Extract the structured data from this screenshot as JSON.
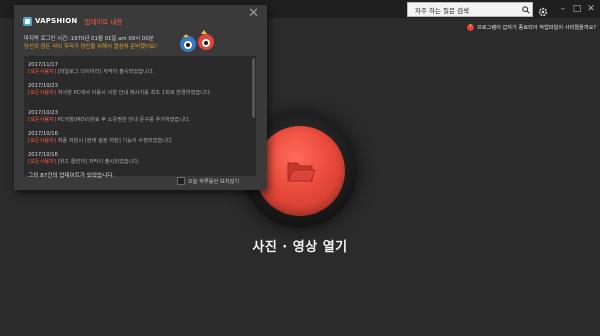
{
  "titlebar": {
    "search_placeholder": "자주 하는 질문 검색",
    "controls": [
      "–",
      "□",
      "✕"
    ]
  },
  "notice": {
    "badge": "!",
    "text": "프로그램이 갑자기 종료되어 작업파일이 사라졌을까요?"
  },
  "main": {
    "open_label": "사진 · 영상 열기"
  },
  "dialog": {
    "brand": "VAPSHION",
    "title": "업데이트 내용",
    "intro_line1_prefix": "마지막 로그인 시간: ",
    "intro_line1_value": "1970년 01월 01일 am 09시 00분",
    "intro_line2": "당신의 잠든 사이 우리가 당신을 위해서 열심히 준비했어요!",
    "entries": [
      {
        "date": "2017/11/17",
        "tag": "[모든사용자]",
        "text": "[마일로그 다이어리] 자막이 출시되었습니다."
      },
      {
        "date": "2017/10/23",
        "tag": "[모든사용자]",
        "text": "저사양 PC에서 이용시 사양 안내 메시지를 최초 1회로 변경하였습니다."
      },
      {
        "date": "2017/10/23",
        "tag": "[모든사용자]",
        "text": "PC저장(MOV)완료 후 소유권한 안내 문구를 추가하였습니다."
      },
      {
        "date": "2017/10/16",
        "tag": "[모든사용자]",
        "text": "최종 저장시 [현재 설정 저장] 기능이 수정되었습니다."
      },
      {
        "date": "2017/10/16",
        "tag": "[모든사용자]",
        "text": "[위즈 클린자] 자막이 출시되었습니다."
      }
    ],
    "footer": "그외 87건의 업데이트가 있었습니다.",
    "hide_today": "오늘 하루동안 보지않기"
  }
}
